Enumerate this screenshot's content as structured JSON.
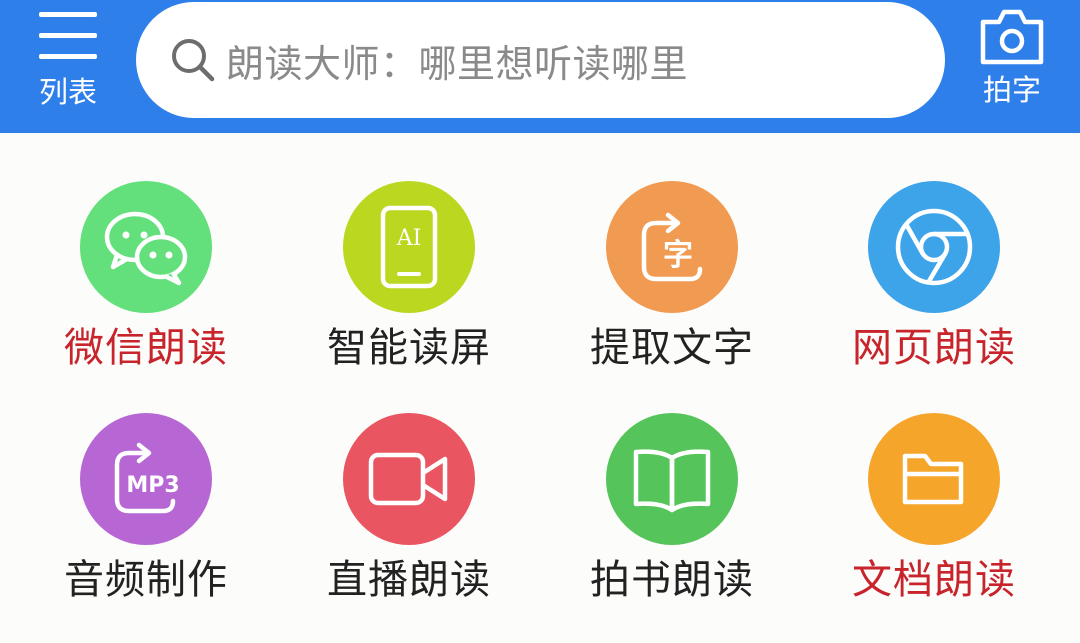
{
  "header": {
    "menu_label": "列表",
    "search_placeholder": "朗读大师：哪里想听读哪里",
    "camera_label": "拍字"
  },
  "colors": {
    "header_bg": "#2f7fea",
    "label_red": "#c8242c",
    "label_dark": "#222222"
  },
  "features": [
    {
      "label": "微信朗读",
      "icon": "wechat-icon",
      "bg": "#63e07c",
      "text_color": "#c8242c"
    },
    {
      "label": "智能读屏",
      "icon": "ai-phone-icon",
      "bg": "#bbd71f",
      "text_color": "#222222"
    },
    {
      "label": "提取文字",
      "icon": "extract-text-icon",
      "bg": "#f19a52",
      "text_color": "#222222"
    },
    {
      "label": "网页朗读",
      "icon": "browser-icon",
      "bg": "#3ea4ea",
      "text_color": "#c8242c"
    },
    {
      "label": "音频制作",
      "icon": "mp3-icon",
      "bg": "#b667d4",
      "text_color": "#222222",
      "icon_text": "MP3"
    },
    {
      "label": "直播朗读",
      "icon": "video-camera-icon",
      "bg": "#e95560",
      "text_color": "#222222"
    },
    {
      "label": "拍书朗读",
      "icon": "book-icon",
      "bg": "#55c45b",
      "text_color": "#222222"
    },
    {
      "label": "文档朗读",
      "icon": "folder-icon",
      "bg": "#f5a52a",
      "text_color": "#c8242c"
    }
  ],
  "icon_texts": {
    "ai": "AI",
    "zi": "字",
    "mp3": "MP3"
  }
}
